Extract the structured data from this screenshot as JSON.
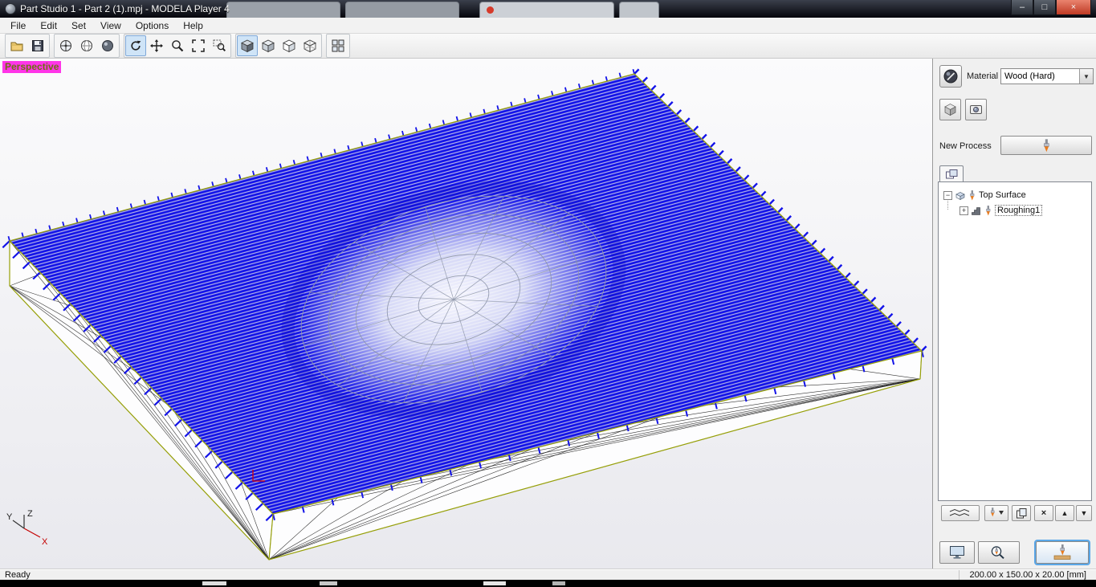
{
  "window": {
    "title": "Part Studio 1 - Part 2 (1).mpj - MODELA Player 4"
  },
  "titlebar": {
    "minimize": "–",
    "maximize": "□",
    "close": "×"
  },
  "menu": {
    "items": [
      "File",
      "Edit",
      "Set",
      "View",
      "Options",
      "Help"
    ]
  },
  "toolbar": {
    "icons": [
      "open-file",
      "save",
      "view-center",
      "view-globe",
      "view-shaded-sphere",
      "rotate-view",
      "pan-view",
      "zoom",
      "fit-to-window",
      "zoom-region",
      "display-shaded",
      "display-light",
      "display-hidden-line",
      "display-wireframe",
      "four-pane-layout"
    ],
    "active_buttons": [
      "rotate-view",
      "display-shaded"
    ]
  },
  "viewport": {
    "view_label": "Perspective",
    "origin_axes": [
      "Y",
      "Z",
      "X"
    ]
  },
  "panel": {
    "material_label": "Material",
    "material_value": "Wood (Hard)",
    "new_process_label": "New Process",
    "tree": [
      {
        "label": "Top Surface",
        "expand": "−"
      },
      {
        "label": "Roughing1",
        "expand": "+"
      }
    ],
    "icons": {
      "dropdown": "▼",
      "up": "▲",
      "down": "▼",
      "delete": "×"
    }
  },
  "statusbar": {
    "status": "Ready",
    "model_size": "200.00 x 150.00 x 20.00 [mm]"
  },
  "colors": {
    "toolpath": "#1313e8",
    "edges": "#97a008",
    "view_label_bg": "#ff35e8"
  }
}
